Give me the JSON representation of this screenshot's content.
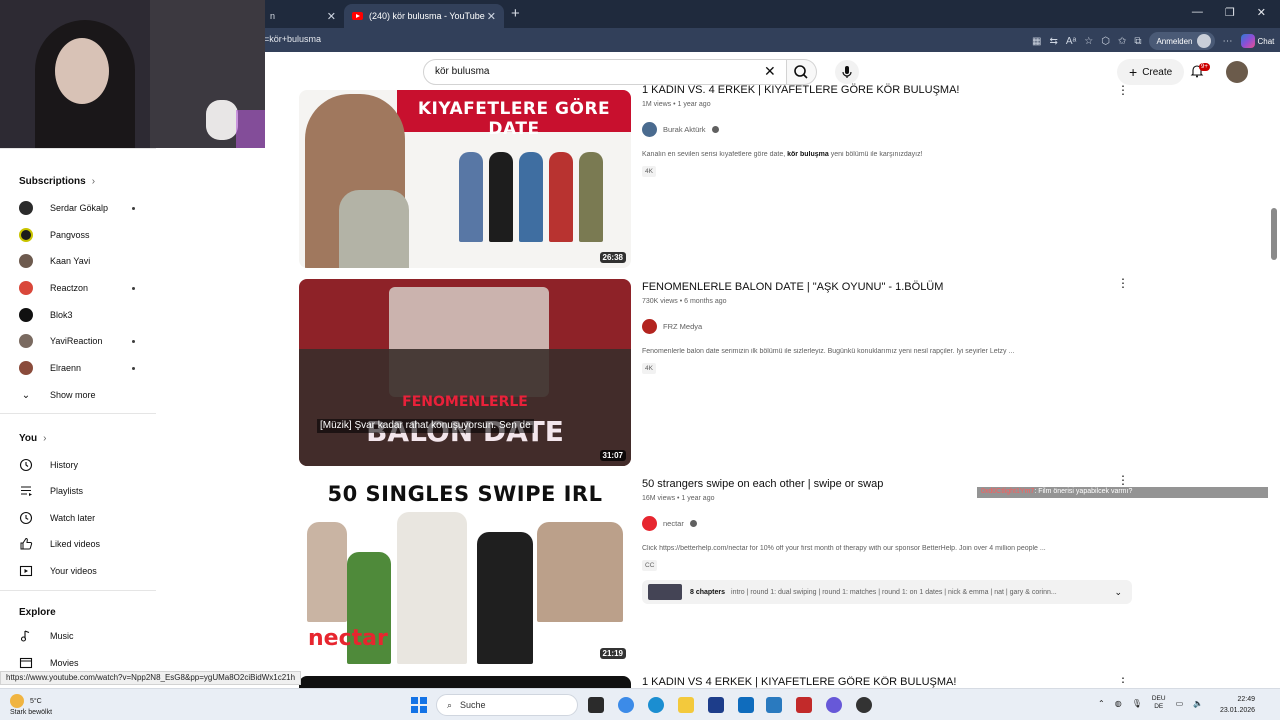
{
  "browser": {
    "tabs": [
      {
        "title": "n",
        "active": false
      },
      {
        "title": "(240) kör bulusma - YouTube",
        "active": true
      }
    ],
    "url": "=kör+bulusma",
    "account_button": "Anmelden",
    "chat_button": "Chat"
  },
  "yt_header": {
    "search_value": "kör bulusma",
    "create_label": "Create",
    "notifications_badge": "9+"
  },
  "sidebar": {
    "subscriptions_label": "Subscriptions",
    "subscriptions": [
      {
        "name": "Serdar Gökalp",
        "color": "#2b2b2b",
        "dot": true
      },
      {
        "name": "Pangvoss",
        "color": "#1b1b1b",
        "dot": false
      },
      {
        "name": "Kaan Yavi",
        "color": "#6d5a4e",
        "dot": false
      },
      {
        "name": "Reactzon",
        "color": "#d9473a",
        "dot": true
      },
      {
        "name": "Blok3",
        "color": "#111111",
        "dot": false
      },
      {
        "name": "YaviReaction",
        "color": "#7a6a60",
        "dot": true
      },
      {
        "name": "Elraenn",
        "color": "#8a4b3b",
        "dot": true
      }
    ],
    "show_more": "Show more",
    "you_label": "You",
    "you_items": [
      "History",
      "Playlists",
      "Watch later",
      "Liked videos",
      "Your videos"
    ],
    "explore_label": "Explore",
    "explore_items": [
      "Music",
      "Movies"
    ]
  },
  "results": [
    {
      "title": "1 KADIN VS. 4 ERKEK | KIYAFETLERE GÖRE KÖR BULUŞMA!",
      "stats": "1M views • 1 year ago",
      "channel": "Burak Aktürk",
      "verified": true,
      "desc_before": "Kanalın en sevilen serisi kıyafetlere göre date, ",
      "desc_bold": "kör buluşma",
      "desc_after": " yeni bölümü ile karşınızdayız!",
      "badge": "4K",
      "duration": "26:38",
      "thumb_text": "KIYAFETLERE GÖRE DATE"
    },
    {
      "title": "FENOMENLERLE BALON DATE | \"AŞK OYUNU\" - 1.BÖLÜM",
      "stats": "730K views • 6 months ago",
      "channel": "FRZ Medya",
      "verified": false,
      "desc": "Fenomenlerle balon date serimizin ilk bölümü ile sizlerleyiz. Bugünkü konuklarımız yeni nesil rapçiler. İyi seyirler Letzy ...",
      "badge": "4K",
      "duration": "31:07",
      "thumb_text_1": "FENOMENLERLE",
      "thumb_text_2": "BALON DATE",
      "caption": "[Müzik] Şvar kadar rahat konuşuyorsun. Sen de"
    },
    {
      "title": "50 strangers swipe on each other | swipe or swap",
      "stats": "16M views • 1 year ago",
      "channel": "nectar",
      "verified": true,
      "desc": "Click https://betterhelp.com/nectar for 10% off your first month of therapy with our sponsor BetterHelp. Join over 4 million people ...",
      "badge": "CC",
      "chapters_count": "8 chapters",
      "chapters_text": "intro | round 1: dual swiping | round 1: matches | round 1: on 1 dates | nick & emma | nat | gary & corinn...",
      "duration": "21:19",
      "thumb_text": "50 SINGLES SWIPE IRL",
      "thumb_brand": "nectar"
    },
    {
      "title": "1 KADIN VS 4 ERKEK | KIYAFETLERE GÖRE KÖR BULUŞMA!"
    }
  ],
  "chat": {
    "user": "0xd0Ctlight1Ym7",
    "message": ": Film önerisi yapabilcek varmı?"
  },
  "status_url": "https://www.youtube.com/watch?v=Npp2N8_EsG8&pp=ygUMa8O2ciBidWx1c21h",
  "taskbar": {
    "temp": "5°C",
    "weather": "Stark bewölkt",
    "search": "Suche",
    "lang_1": "DEU",
    "lang_2": "DE",
    "time": "22:49",
    "date": "23.01.2026"
  }
}
